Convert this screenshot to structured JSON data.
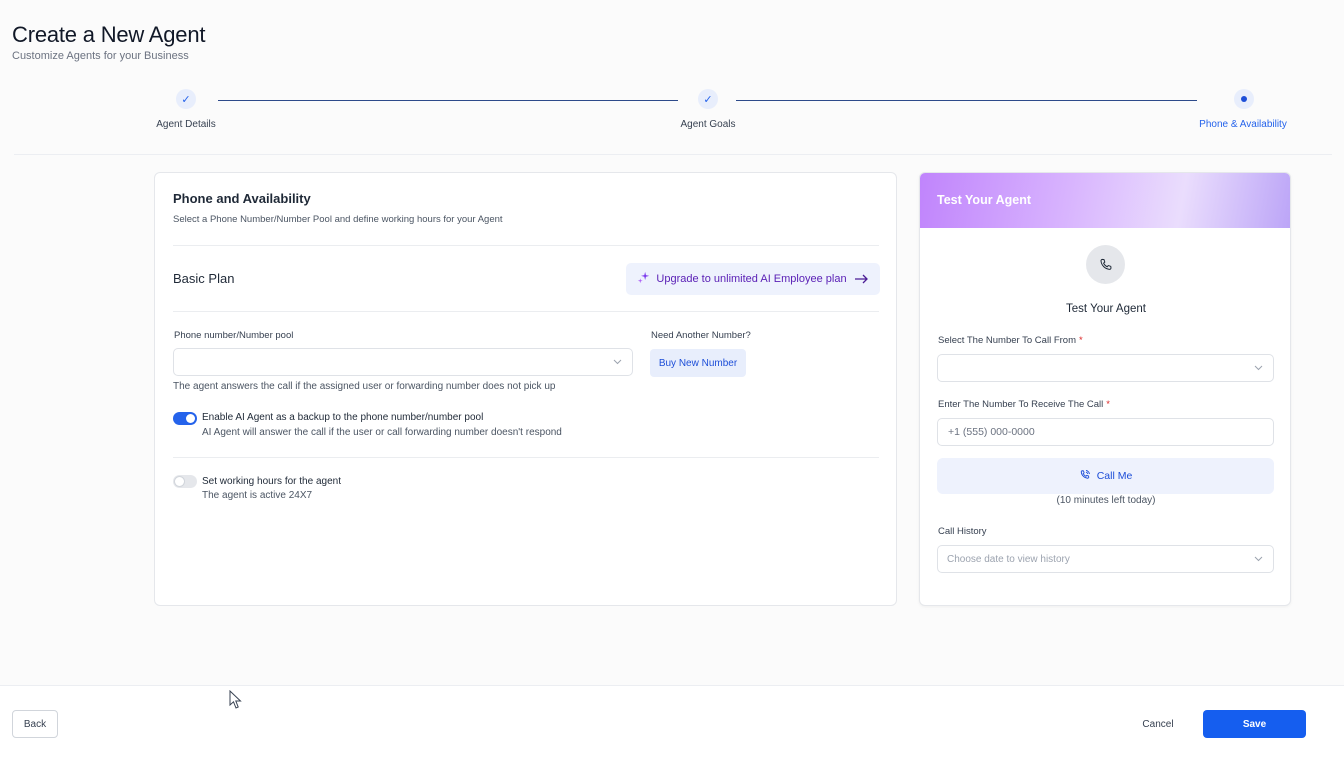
{
  "header": {
    "title": "Create a New Agent",
    "subtitle": "Customize Agents for your Business"
  },
  "stepper": {
    "steps": [
      {
        "label": "Agent Details",
        "status": "complete"
      },
      {
        "label": "Agent Goals",
        "status": "complete"
      },
      {
        "label": "Phone & Availability",
        "status": "current"
      }
    ],
    "check_glyph": "✓"
  },
  "phone_section": {
    "title": "Phone and Availability",
    "subtitle": "Select a Phone Number/Number Pool and define working hours for your Agent",
    "plan_label": "Basic Plan",
    "upgrade_label": "Upgrade to unlimited AI Employee plan",
    "phone_field_label": "Phone number/Number pool",
    "phone_field_value": "",
    "need_another_label": "Need Another Number?",
    "buy_button_label": "Buy New Number",
    "phone_hint": "The agent answers the call if the assigned user or forwarding number does not pick up",
    "backup_toggle": {
      "on": true,
      "title": "Enable AI Agent as a backup to the phone number/number pool",
      "description": "AI Agent will answer the call if the user or call forwarding number doesn't respond"
    },
    "hours_toggle": {
      "on": false,
      "title": "Set working hours for the agent",
      "description": "The agent is active 24X7"
    }
  },
  "test_panel": {
    "header_title": "Test Your Agent",
    "title": "Test Your Agent",
    "from_label": "Select The Number To Call From",
    "from_value": "",
    "to_label": "Enter The Number To Receive The Call",
    "to_placeholder": "+1 (555) 000-0000",
    "required_mark": "*",
    "call_button_label": "Call Me",
    "minutes_left": "(10 minutes left today)",
    "history_label": "Call History",
    "history_placeholder": "Choose date to view history"
  },
  "footer": {
    "back_label": "Back",
    "cancel_label": "Cancel",
    "save_label": "Save"
  },
  "colors": {
    "primary": "#155eef",
    "accent_purple": "#7c3aed",
    "required": "#dc2626"
  },
  "icons": {
    "check": "check-icon",
    "sparkle": "sparkle-icon",
    "arrow": "arrow-right-icon",
    "phone": "phone-icon",
    "phone_call": "phone-call-icon",
    "chevron": "chevron-down-icon",
    "cursor": "mouse-cursor-icon"
  }
}
